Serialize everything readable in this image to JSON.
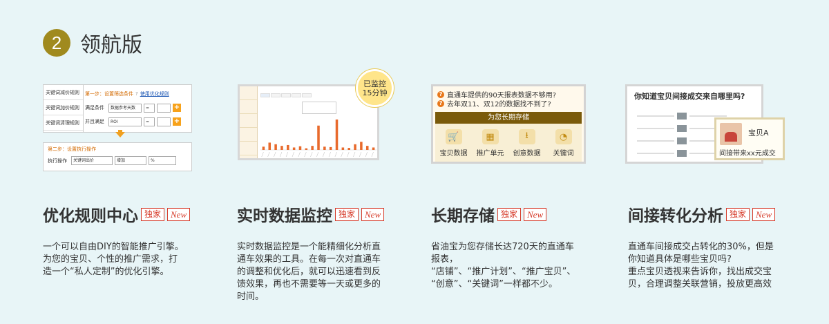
{
  "header": {
    "number": "2",
    "title": "领航版"
  },
  "cards": [
    {
      "title": "优化规则中心",
      "badge1": "独家",
      "badge2": "New",
      "desc": "一个可以自由DIY的智能推广引擎。\n为您的宝贝、个性的推广需求，打\n造一个“私人定制”的优化引擎。"
    },
    {
      "title": "实时数据监控",
      "badge1": "独家",
      "badge2": "New",
      "desc": "实时数据监控是一个能精细化分析直\n通车效果的工具。在每一次对直通车\n的调整和优化后，就可以迅速看到反\n馈效果，再也不需要等一天或更多的\n时间。"
    },
    {
      "title": "长期存储",
      "badge1": "独家",
      "badge2": "New",
      "desc": "  省油宝为您存储长达720天的直通车\n报表，\n“店铺”、“推广计划”、“推广宝贝”、\n“创意”、“关键词”一样都不少。"
    },
    {
      "title": "间接转化分析",
      "badge1": "独家",
      "badge2": "New",
      "desc": "直通车间接成交占转化的30%，但是\n你知道具体是哪些宝贝吗?\n重点宝贝透视来告诉你，找出成交宝\n贝，合理调整关联营销，投放更高效"
    }
  ],
  "thumb_rules": {
    "left_items": [
      "关键词减价规则",
      "关键词加价规则",
      "关键词清理规则"
    ],
    "step1": "第一步：设置筛选条件",
    "step1_link": "使用优化规则",
    "cond1_label": "满足条件",
    "cond1_select": "数据参考天数",
    "cond1_op": "=",
    "cond2_label": "并且满足",
    "cond2_select": "ROI",
    "cond2_op": "=",
    "step2": "第二步：设置执行操作",
    "action_label": "执行操作",
    "action_select": "关键词出价",
    "action_mode": "增加",
    "action_unit": "%"
  },
  "thumb_monitor": {
    "bubble_line1": "已监控",
    "bubble_line2": "15分钟",
    "bars": [
      8,
      18,
      14,
      10,
      12,
      6,
      9,
      4,
      10,
      60,
      8,
      7,
      75,
      6,
      5,
      14,
      20,
      10,
      6
    ],
    "bar_color": "#e86a2c"
  },
  "thumb_storage": {
    "q1": "直通车提供的90天报表数据不够用?",
    "q2": "去年双11、双12的数据找不到了?",
    "bar_title": "为您长期存储",
    "items": [
      "宝贝数据",
      "推广单元",
      "创意数据",
      "关键词"
    ]
  },
  "thumb_indirect": {
    "question": "你知道宝贝间接成交来自哪里吗?",
    "popup_name": "宝贝A",
    "popup_text": "间接带来xx元成交"
  }
}
